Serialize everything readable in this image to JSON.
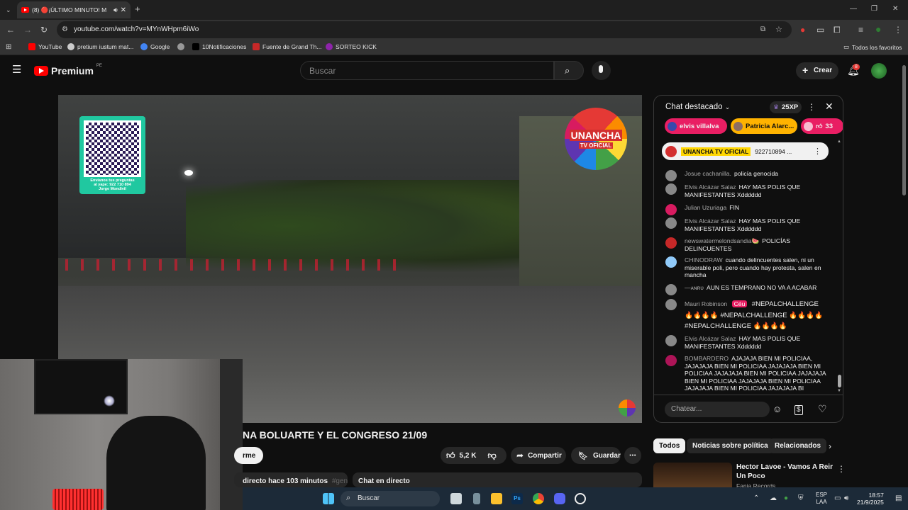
{
  "browser": {
    "tab_title": "(8) 🔴¡ÚLTIMO MINUTO! M",
    "url": "youtube.com/watch?v=MYnWHpm6iWo",
    "bookmarks": [
      "YouTube",
      "pretium iustum mat...",
      "Google",
      "10Notificaciones",
      "Fuente de Grand Th...",
      "SORTEO KICK"
    ],
    "all_bookmarks": "Todos los favoritos"
  },
  "youtube": {
    "logo": "Premium",
    "region": "PE",
    "search_placeholder": "Buscar",
    "create_label": "Crear",
    "notifications_count": "8"
  },
  "video": {
    "qr_caption_line1": "Envíanos tus preguntas",
    "qr_caption_line2": "al yape: 922 710 894",
    "qr_caption_line3": "Jorge Mondivil",
    "channel_logo_line1": "UNANCHA",
    "channel_logo_line2": "TV OFICIAL",
    "title": "NA BOLUARTE Y EL CONGRESO 21/09",
    "subscribe_fragment": "rme",
    "likes": "5,2 K",
    "share_label": "Compartir",
    "save_label": "Guardar",
    "live_info": "directo hace 103 minutos",
    "hashtag_fragment": "#gen",
    "live_chat_label": "Chat en directo"
  },
  "chat": {
    "header": "Chat destacado",
    "xp": "25XP",
    "tickers": [
      {
        "name": "elvis villalva",
        "color": "#e91e63"
      },
      {
        "name": "Patricia Alarc...",
        "color": "#ffb300"
      },
      {
        "name": "33",
        "color": "#e91e63"
      }
    ],
    "pinned": {
      "tag": "UNANCHA TV OFICIAL",
      "text": "922710894 ..."
    },
    "messages": [
      {
        "author": "Josue cachanilla.",
        "text": "policía genocida"
      },
      {
        "author": "Elvis Alcázar Salaz",
        "text": "HAY MAS POLIS QUE MANIFESTANTES Xdddddd"
      },
      {
        "author": "Julian Uzuriaga",
        "text": "FIN"
      },
      {
        "author": "Elvis Alcázar Salaz",
        "text": "HAY MAS POLIS QUE MANIFESTANTES Xdddddd"
      },
      {
        "author": "newswatermelondsandia🍉",
        "text": "POLICÍAS DELINCUENTES"
      },
      {
        "author": "CHINODRAW",
        "text": "cuando delincuentes salen, ni un miserable poli, pero cuando hay protesta, salen en mancha"
      },
      {
        "author": "—ᴀɴʀᴜ",
        "text": "AUN ES TEMPRANO NO VA A ACABAR"
      },
      {
        "author": "Mauri Robinson",
        "badge": "Céu",
        "text": "#NEPALCHALLENGE 🔥🔥🔥🔥 #NEPALCHALLENGE 🔥🔥🔥🔥 #NEPALCHALLENGE 🔥🔥🔥🔥"
      },
      {
        "author": "Elvis Alcázar Salaz",
        "text": "HAY MAS POLIS QUE MANIFESTANTES Xdddddd"
      },
      {
        "author": "BOMBARDERO",
        "text": "AJAJAJA BIEN MI POLICIAA, JAJAJAJA BIEN MI POLICIAA JAJAJAJA BIEN MI POLICIAA JAJAJAJA BIEN MI POLICIAA JAJAJAJA BIEN MI POLICIAA JAJAJAJA BIEN MI POLICIAA JAJAJAJA BIEN MI POLICIAA JAJAJAJA BI"
      }
    ],
    "input_placeholder": "Chatear..."
  },
  "related": {
    "chips": [
      "Todos",
      "Noticias sobre política",
      "Relacionados"
    ],
    "first_title": "Hector Lavoe - Vamos A Reir Un Poco",
    "first_channel": "Fania Records"
  },
  "taskbar": {
    "search": "Buscar",
    "lang1": "ESP",
    "lang2": "LAA",
    "time": "18:57",
    "date": "21/9/2025"
  }
}
